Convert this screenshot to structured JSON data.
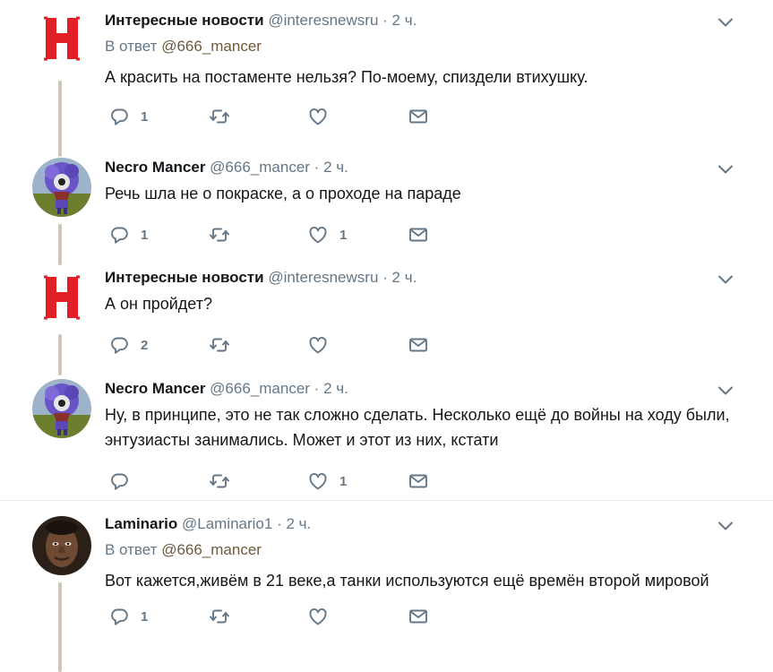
{
  "tweets": [
    {
      "name": "Интересные новости",
      "handle": "@interesnewsru",
      "dot": "·",
      "time": "2 ч.",
      "reply_prefix": "В ответ",
      "reply_to": "@666_mancer",
      "text": "А красить на постаменте нельзя? По-моему, спиздели втихушку.",
      "replies": "1",
      "retweets": "",
      "likes": ""
    },
    {
      "name": "Necro Mancer",
      "handle": "@666_mancer",
      "dot": "·",
      "time": "2 ч.",
      "text": "Речь шла не о покраске, а о проходе на параде",
      "replies": "1",
      "retweets": "",
      "likes": "1"
    },
    {
      "name": "Интересные новости",
      "handle": "@interesnewsru",
      "dot": "·",
      "time": "2 ч.",
      "text": "А он пройдет?",
      "replies": "2",
      "retweets": "",
      "likes": ""
    },
    {
      "name": "Necro Mancer",
      "handle": "@666_mancer",
      "dot": "·",
      "time": "2 ч.",
      "text": "Ну, в принципе, это не так сложно сделать. Несколько ещё до войны на ходу были, энтузиасты занимались. Может и этот из них, кстати",
      "replies": "",
      "retweets": "",
      "likes": "1"
    },
    {
      "name": "Laminario",
      "handle": "@Laminario1",
      "dot": "·",
      "time": "2 ч.",
      "reply_prefix": "В ответ",
      "reply_to": "@666_mancer",
      "text": "Вот кажется,живём в 21 веке,а танки используются ещё времён второй мировой",
      "replies": "1",
      "retweets": "",
      "likes": ""
    }
  ],
  "icons": {
    "reply": "reply-icon",
    "retweet": "retweet-icon",
    "like": "heart-icon",
    "dm": "envelope-icon",
    "caret": "chevron-down-icon"
  },
  "colors": {
    "brand_red": "#e21f26",
    "thread_line": "#cfc6b4",
    "secondary_text": "#657786",
    "mention": "#6b5a3c",
    "icon": "#657786"
  }
}
